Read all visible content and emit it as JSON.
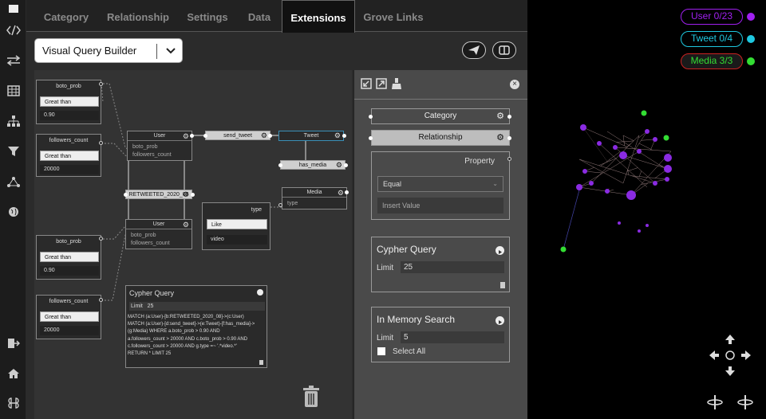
{
  "tabs": [
    "Category",
    "Relationship",
    "Settings",
    "Data",
    "Extensions",
    "Grove Links"
  ],
  "mode_select": "Visual Query Builder",
  "canvas": {
    "filters": [
      {
        "title": "boto_prob",
        "op": "Great than",
        "value": "0.90"
      },
      {
        "title": "followers_count",
        "op": "Great than",
        "value": "20000"
      },
      {
        "title": "boto_prob",
        "op": "Great than",
        "value": "0.90"
      },
      {
        "title": "followers_count",
        "op": "Great than",
        "value": "20000"
      }
    ],
    "user1": {
      "title": "User",
      "p1": "boto_prob",
      "p2": "followers_count"
    },
    "user2": {
      "title": "User",
      "p1": "boto_prob",
      "p2": "followers_count"
    },
    "rel_send": "send_tweet",
    "rel_retweet": "RETWEETED_2020_08",
    "rel_media": "has_media",
    "tweet": "Tweet",
    "media": {
      "title": "Media",
      "p1": "type"
    },
    "type_filter": {
      "title": "type",
      "op": "Like",
      "value": "video"
    },
    "cypher": {
      "title": "Cypher Query",
      "limit_label": "Limit",
      "limit": "25",
      "lines": [
        "MATCH (a:User)-[b:RETWEETED_2020_08]->(c:User)",
        "MATCH (a:User)-[d:send_tweet]->(e:Tweet)-[f:has_media]->",
        "(g:Media) WHERE a.boto_prob > 0.90 AND",
        "a.followers_count > 20000 AND c.boto_prob > 0.90 AND",
        "c.followers_count > 20000 AND g.type =~ '.*video.*'",
        "RETURN * LIMIT 25"
      ]
    }
  },
  "panel": {
    "category": "Category",
    "relationship": "Relationship",
    "property": "Property",
    "operator": "Equal",
    "insert_placeholder": "Insert Value",
    "cypher_title": "Cypher Query",
    "limit_label": "Limit",
    "cypher_limit": "25",
    "memory_title": "In Memory Search",
    "memory_limit": "5",
    "select_all": "Select All"
  },
  "legend": [
    {
      "label": "User 0/23",
      "color": "#a020f0"
    },
    {
      "label": "Tweet 0/4",
      "color": "#1ec8e0"
    },
    {
      "label": "Media 3/3",
      "color": "#33dd33",
      "border": "#cc2222"
    }
  ]
}
